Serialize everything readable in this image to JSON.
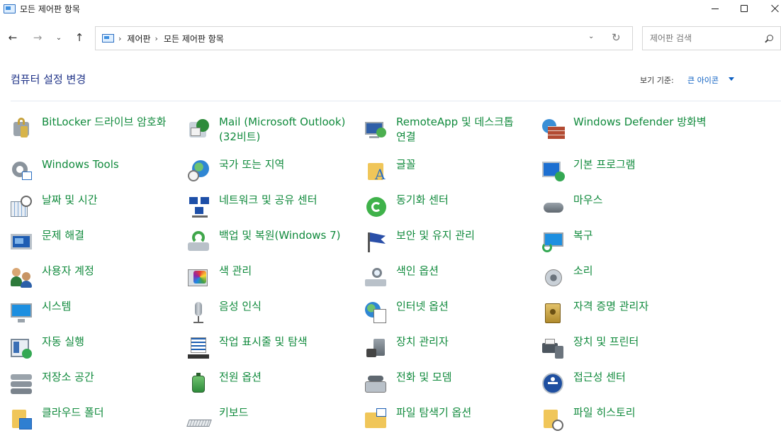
{
  "window": {
    "title": "모든 제어판 항목",
    "controls": [
      "minimize",
      "maximize",
      "close"
    ]
  },
  "nav": {
    "breadcrumb": [
      "제어판",
      "모든 제어판 항목"
    ],
    "search_placeholder": "제어판 검색"
  },
  "header": {
    "title": "컴퓨터 설정 변경",
    "view_by_label": "보기 기준:",
    "view_by_value": "큰 아이콘"
  },
  "colors": {
    "item_text": "#108a3c",
    "title_text": "#1e3287",
    "link": "#0b5fc2"
  },
  "items": [
    {
      "label": "BitLocker 드라이브 암호화",
      "icon": "bitlocker-icon"
    },
    {
      "label": "Mail (Microsoft Outlook)(32비트)",
      "icon": "mail-icon"
    },
    {
      "label": "RemoteApp 및 데스크톱 연결",
      "icon": "remoteapp-icon"
    },
    {
      "label": "Windows Defender 방화벽",
      "icon": "firewall-icon"
    },
    {
      "label": "Windows Tools",
      "icon": "windows-tools-icon"
    },
    {
      "label": "국가 또는 지역",
      "icon": "region-icon"
    },
    {
      "label": "글꼴",
      "icon": "fonts-icon"
    },
    {
      "label": "기본 프로그램",
      "icon": "default-programs-icon"
    },
    {
      "label": "날짜 및 시간",
      "icon": "date-time-icon"
    },
    {
      "label": "네트워크 및 공유 센터",
      "icon": "network-icon"
    },
    {
      "label": "동기화 센터",
      "icon": "sync-center-icon"
    },
    {
      "label": "마우스",
      "icon": "mouse-icon"
    },
    {
      "label": "문제 해결",
      "icon": "troubleshooting-icon"
    },
    {
      "label": "백업 및 복원(Windows 7)",
      "icon": "backup-restore-icon"
    },
    {
      "label": "보안 및 유지 관리",
      "icon": "security-maintenance-icon"
    },
    {
      "label": "복구",
      "icon": "recovery-icon"
    },
    {
      "label": "사용자 계정",
      "icon": "user-accounts-icon"
    },
    {
      "label": "색 관리",
      "icon": "color-management-icon"
    },
    {
      "label": "색인 옵션",
      "icon": "indexing-options-icon"
    },
    {
      "label": "소리",
      "icon": "sound-icon"
    },
    {
      "label": "시스템",
      "icon": "system-icon"
    },
    {
      "label": "음성 인식",
      "icon": "speech-recognition-icon"
    },
    {
      "label": "인터넷 옵션",
      "icon": "internet-options-icon"
    },
    {
      "label": "자격 증명 관리자",
      "icon": "credential-manager-icon"
    },
    {
      "label": "자동 실행",
      "icon": "autoplay-icon"
    },
    {
      "label": "작업 표시줄 및 탐색",
      "icon": "taskbar-navigation-icon"
    },
    {
      "label": "장치 관리자",
      "icon": "device-manager-icon"
    },
    {
      "label": "장치 및 프린터",
      "icon": "devices-printers-icon"
    },
    {
      "label": "저장소 공간",
      "icon": "storage-spaces-icon"
    },
    {
      "label": "전원 옵션",
      "icon": "power-options-icon"
    },
    {
      "label": "전화 및 모뎀",
      "icon": "phone-modem-icon"
    },
    {
      "label": "접근성 센터",
      "icon": "ease-of-access-icon"
    },
    {
      "label": "클라우드 폴더",
      "icon": "cloud-folder-icon"
    },
    {
      "label": "키보드",
      "icon": "keyboard-icon"
    },
    {
      "label": "파일 탐색기 옵션",
      "icon": "file-explorer-options-icon"
    },
    {
      "label": "파일 히스토리",
      "icon": "file-history-icon"
    }
  ]
}
